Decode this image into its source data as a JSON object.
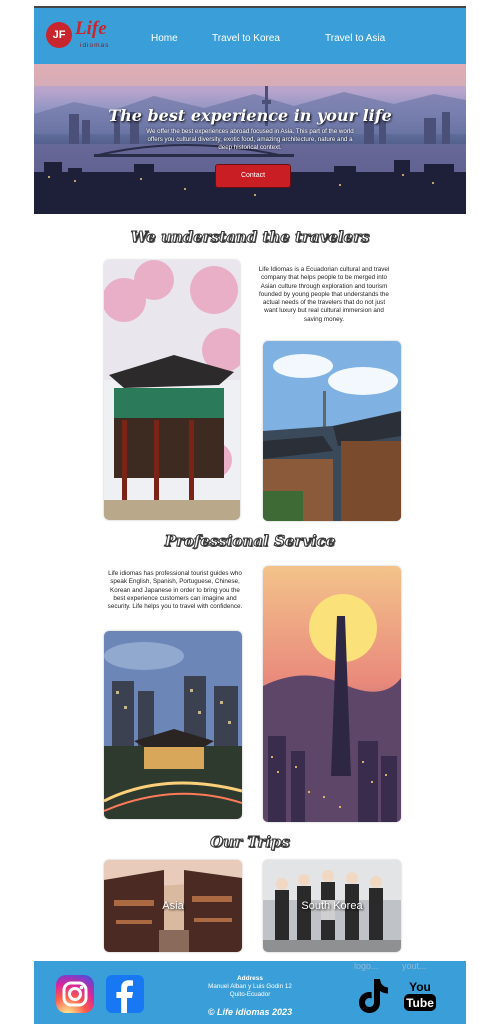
{
  "brand": {
    "logo_initials": "JF",
    "logo_word": "Life",
    "logo_sub": "idiomas"
  },
  "nav": {
    "items": [
      "Home",
      "Travel to Korea",
      "Travel to Asia"
    ]
  },
  "hero": {
    "title": "The best experience in your life",
    "description": "We offer the best experiences abroad focused in Asia. This part of the world offers you cultural diversity, exotic food, amazing architecture, nature and a deep historical context.",
    "button": "Contact"
  },
  "section1": {
    "title": "We understand the travelers",
    "text": "Life Idiomas is a Ecuadorian cultural and travel company that helps people to be merged into Asian culture through exploration and tourism founded by young people that understands the actual needs of the travelers that do not just want luxury but real cultural immersion and saving money."
  },
  "section2": {
    "title": "Professional Service",
    "text": "Life idiomas has professional tourist guides who speak English, Spanish, Portuguese, Chinese, Korean and Japanese in order to bring you the best experience customers can imagine and security. Life helps you to travel with confidence."
  },
  "trips": {
    "title": "Our Trips",
    "items": [
      "Asia",
      "South Korea"
    ]
  },
  "footer": {
    "address_title": "Address",
    "address_line1": "Manuel Alban y Luis Godin 12",
    "address_line2": "Quito-Ecuador",
    "copyright": "© Life idiomas 2023",
    "ghost_logo": "logo...",
    "ghost_yout": "yout...",
    "youtube_top": "You",
    "youtube_bottom": "Tube"
  },
  "colors": {
    "nav": "#3a9fd8",
    "brand_red": "#c8262c",
    "button": "#c81e24"
  }
}
